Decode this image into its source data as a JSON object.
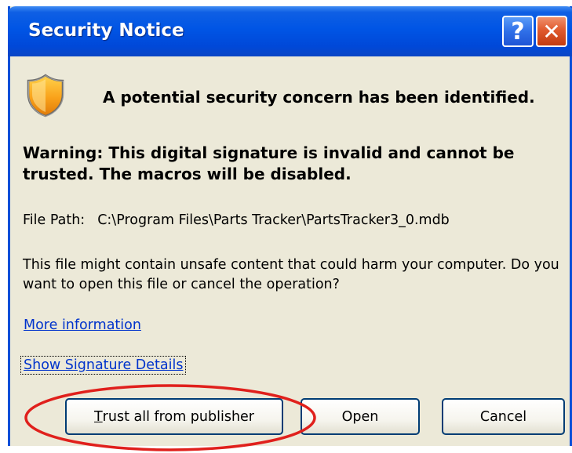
{
  "window": {
    "title": "Security Notice",
    "help_label": "?",
    "close_label": "✕"
  },
  "content": {
    "heading": "A potential security concern has been identified.",
    "warning": "Warning: This digital signature is invalid and cannot be trusted. The macros will be disabled.",
    "file_path_label": "File Path:",
    "file_path_value": "C:\\Program Files\\Parts Tracker\\PartsTracker3_0.mdb",
    "description": "This file might contain unsafe content that could harm your computer. Do you want to open this file or cancel the operation?",
    "more_info_link": "More information",
    "signature_link": "Show Signature Details"
  },
  "buttons": {
    "trust_first_letter": "T",
    "trust_rest": "rust all from publisher",
    "open": "Open",
    "cancel": "Cancel"
  },
  "icons": {
    "shield": "security-shield-icon",
    "help": "help-icon",
    "close": "close-icon"
  },
  "colors": {
    "titlebar": "#0055e5",
    "dialog_background": "#ece9d8",
    "link": "#0033cc",
    "annotation_circle": "#e0201c",
    "close_button": "#e05a2e"
  }
}
